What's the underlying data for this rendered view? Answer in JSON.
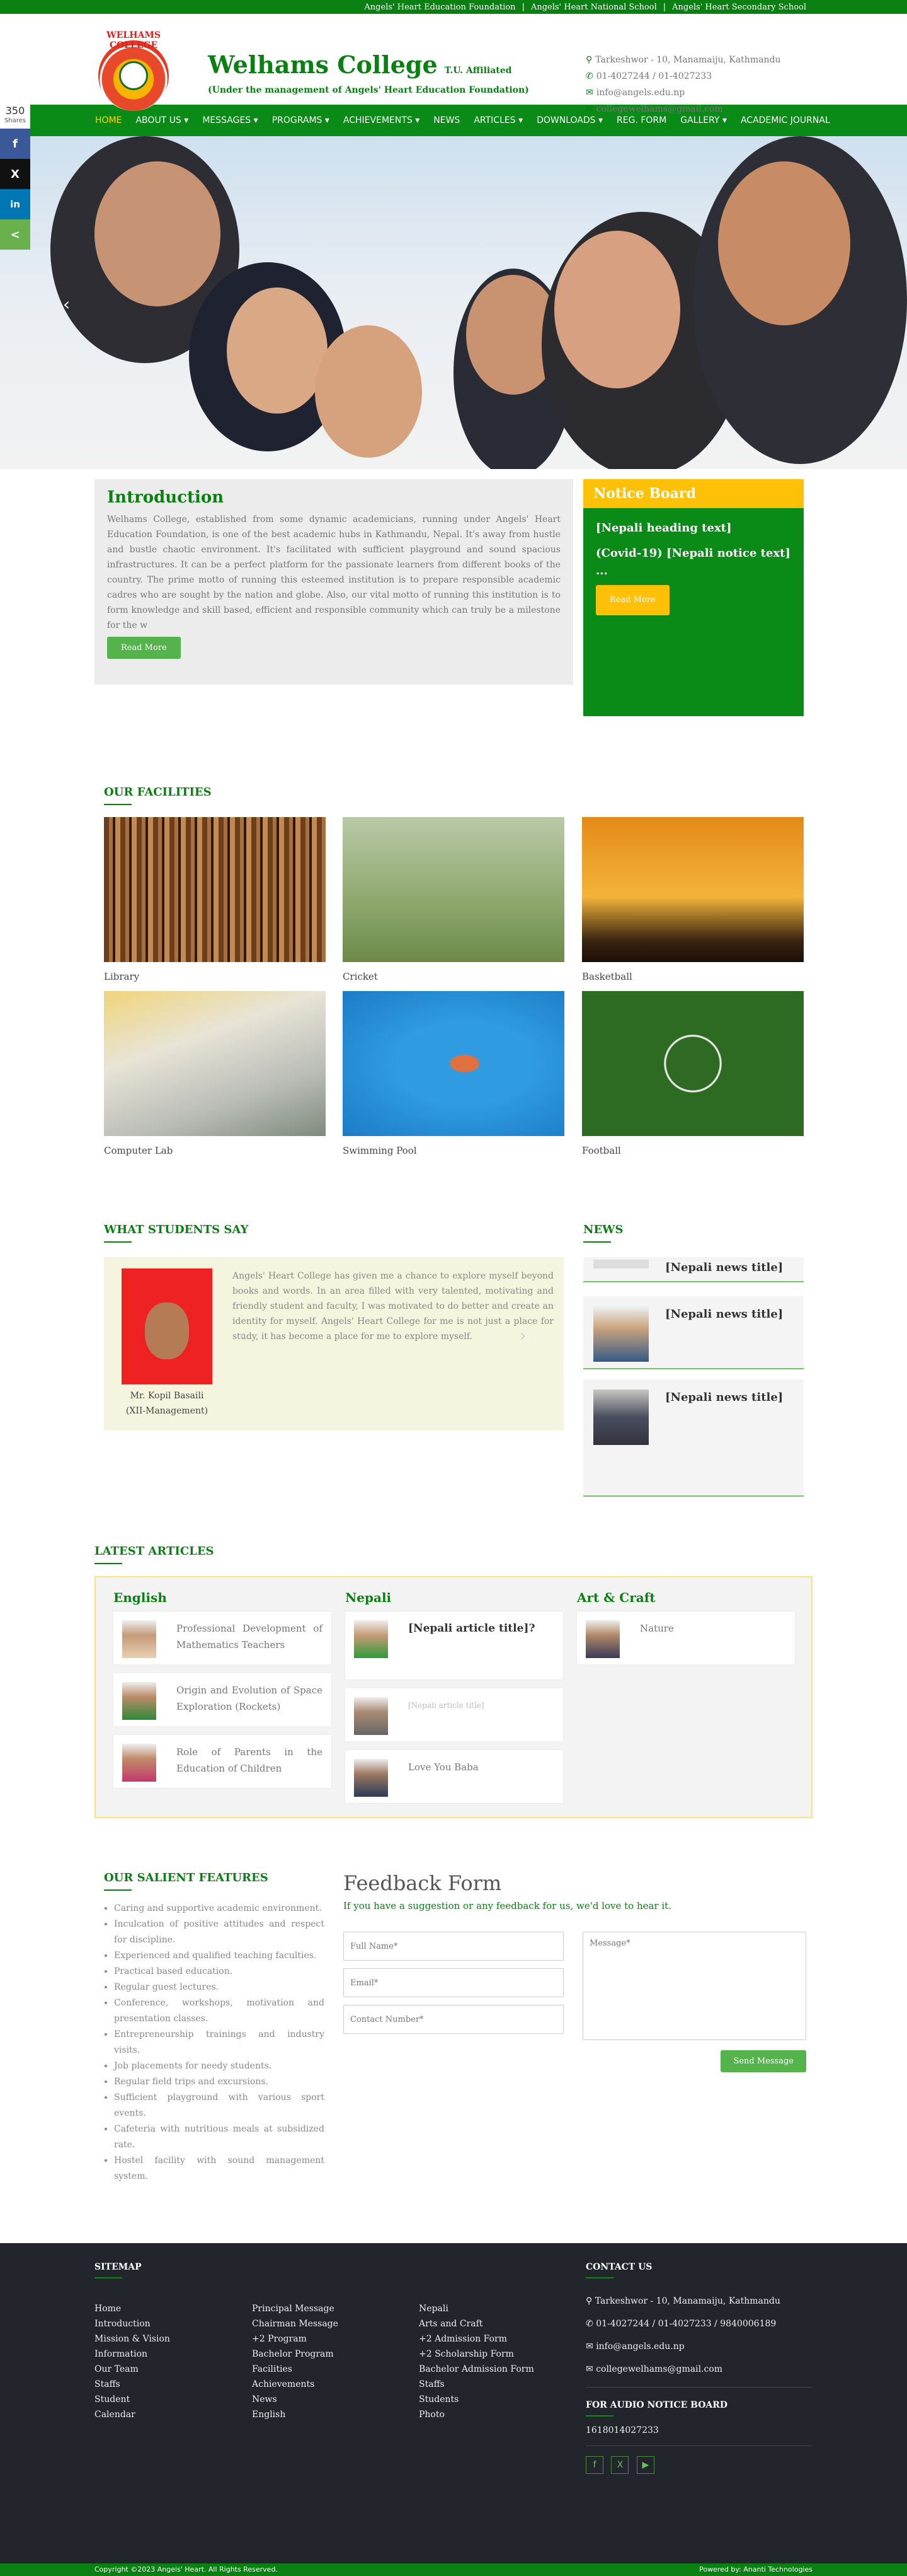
{
  "topbar": {
    "links": [
      "Angels' Heart Education Foundation",
      "Angels' Heart National School",
      "Angels' Heart Secondary School"
    ]
  },
  "header": {
    "logo_text": "WELHAMS COLLEGE",
    "title": "Welhams College",
    "affiliation": "T.U. Affiliated",
    "subtitle": "(Under the management of Angels' Heart Education Foundation)",
    "address": "Tarkeshwor - 10, Manamaiju, Kathmandu",
    "phone": "01-4027244 / 01-4027233",
    "email1": "info@angels.edu.np",
    "email2": "collegewelhams@gmail.com"
  },
  "nav": [
    "HOME",
    "ABOUT US",
    "MESSAGES",
    "PROGRAMS",
    "ACHIEVEMENTS",
    "NEWS",
    "ARTICLES",
    "DOWNLOADS",
    "REG. FORM",
    "GALLERY",
    "ACADEMIC JOURNAL"
  ],
  "nav_dropdown": [
    "",
    "▾",
    "▾",
    "▾",
    "▾",
    "",
    "▾",
    "▾",
    "",
    "▾",
    ""
  ],
  "social": {
    "count": "350",
    "label": "Shares",
    "fb": "f",
    "x": "X",
    "li": "in",
    "share": "<"
  },
  "hero": {
    "prev": "‹"
  },
  "intro": {
    "title": "Introduction",
    "text": "Welhams College, established from some dynamic academicians, running under Angels' Heart Education Foundation, is one of the best academic hubs in Kathmandu, Nepal. It's away from hustle and bustle chaotic environment. It's facilitated with sufficient playground and sound spacious infrastructures. It can be a perfect platform for the passionate learners from different books of the country. The prime motto of running this esteemed institution is to prepare responsible academic cadres who are sought by the nation and globe. Also, our vital motto of running this institution is to form knowledge and skill based, efficient and responsible community which can truly be a milestone for the w",
    "button": "Read More"
  },
  "notice": {
    "title": "Notice Board",
    "text1": "[Nepali heading text]",
    "text2": "(Covid-19) [Nepali notice text] ...",
    "button": "Read More"
  },
  "facilities": {
    "title": "OUR FACILITIES",
    "items": [
      "Library",
      "Cricket",
      "Basketball",
      "Computer Lab",
      "Swimming Pool",
      "Football"
    ]
  },
  "students": {
    "title": "WHAT STUDENTS SAY",
    "quote": "Angels' Heart College has given me a chance to explore myself beyond books and words. In an area filled with very talented, motivating and friendly student and faculty, I was motivated to do better and create an identity for myself. Angels' Heart College for me is not just a place for study, it has become a place for me to explore myself.",
    "name": "Mr. Kopil Basaili",
    "program": "(XII-Management)",
    "prev": "‹",
    "next": "›"
  },
  "news": {
    "title": "NEWS",
    "items": [
      "[Nepali news title]",
      "[Nepali news title]",
      "[Nepali news title]"
    ]
  },
  "articles": {
    "title": "LATEST ARTICLES",
    "english": {
      "heading": "English",
      "items": [
        "Professional Development of Mathematics Teachers",
        "Origin and Evolution of Space Exploration (Rockets)",
        "Role of Parents in the Education of Children"
      ]
    },
    "nepali": {
      "heading": "Nepali",
      "items": [
        "[Nepali article title]?",
        "[Nepali article title]",
        "Love You Baba"
      ]
    },
    "art": {
      "heading": "Art & Craft",
      "items": [
        "Nature"
      ]
    }
  },
  "features": {
    "title": "OUR SALIENT FEATURES",
    "items": [
      "Caring and supportive academic environment.",
      "Inculcation of positive attitudes and respect for discipline.",
      "Experienced and qualified teaching faculties.",
      "Practical based education.",
      "Regular guest lectures.",
      "Conference, workshops, motivation and presentation classes.",
      "Entrepreneurship trainings and industry visits.",
      "Job placements for needy students.",
      "Regular field trips and excursions.",
      "Sufficient playground with various sport events.",
      "Cafeteria with nutritious meals at subsidized rate.",
      "Hostel facility with sound management system."
    ]
  },
  "feedback": {
    "title": "Feedback Form",
    "subtitle": "If you have a suggestion or any feedback for us, we'd love to hear it.",
    "name_ph": "Full Name*",
    "email_ph": "Email*",
    "contact_ph": "Contact Number*",
    "message_ph": "Message*",
    "send": "Send Message"
  },
  "footer": {
    "sitemap_title": "SITEMAP",
    "col1": [
      "Home",
      "Introduction",
      "Mission & Vision",
      "Information",
      "Our Team",
      "Staffs",
      "Student",
      "Calendar"
    ],
    "col2": [
      "Principal Message",
      "Chairman Message",
      "+2 Program",
      "Bachelor Program",
      "Facilities",
      "Achievements",
      "News",
      "English"
    ],
    "col3": [
      "Nepali",
      "Arts and Craft",
      "+2 Admission Form",
      "+2 Scholarship Form",
      "Bachelor Admission Form",
      "Staffs",
      "Students",
      "Photo"
    ],
    "contact_title": "CONTACT US",
    "address": "Tarkeshwor - 10, Manamaiju, Kathmandu",
    "phone": "01-4027244 / 01-4027233 / 9840006189",
    "email1": "info@angels.edu.np",
    "email2": "collegewelhams@gmail.com",
    "audio_title": "FOR AUDIO NOTICE BOARD",
    "audio_number": "1618014027233",
    "copyright": "Copyright ©2023 Angels' Heart. All Rights Reserved.",
    "powered": "Powered by: Ananti Technologies"
  },
  "colors": {
    "brand": "#0a7f12",
    "accent": "#fec107",
    "fb": "#3b5998",
    "x": "#111111",
    "li": "#0077b5",
    "share": "#6ab04c"
  }
}
